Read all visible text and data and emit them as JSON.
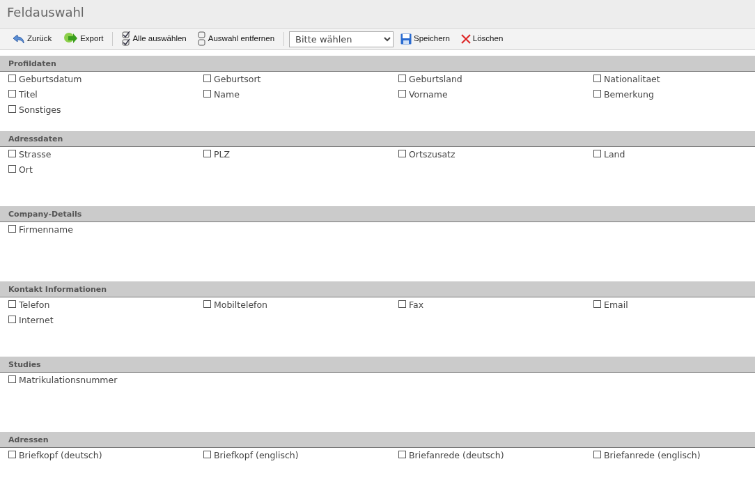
{
  "window": {
    "title": "Feldauswahl"
  },
  "toolbar": [
    {
      "kind": "button",
      "label": "Zurück"
    },
    {
      "kind": "button",
      "label": "Export"
    },
    {
      "kind": "separator"
    },
    {
      "kind": "button",
      "label": "Alle auswählen"
    },
    {
      "kind": "button",
      "label": "Auswahl entfernen"
    },
    {
      "kind": "separator"
    },
    {
      "kind": "select",
      "value": "Bitte wählen"
    },
    {
      "kind": "button",
      "label": "Speichern"
    },
    {
      "kind": "button",
      "label": "Löschen"
    }
  ],
  "sections": [
    {
      "title": "Profildaten",
      "fields": [
        {
          "label": "Geburtsdatum",
          "checked": false
        },
        {
          "label": "Geburtsort",
          "checked": false
        },
        {
          "label": "Geburtsland",
          "checked": false
        },
        {
          "label": "Nationalitaet",
          "checked": false
        },
        {
          "label": "Titel",
          "checked": false
        },
        {
          "label": "Name",
          "checked": false
        },
        {
          "label": "Vorname",
          "checked": false
        },
        {
          "label": "Bemerkung",
          "checked": false
        },
        {
          "label": "Sonstiges",
          "checked": false
        }
      ]
    },
    {
      "title": "Adressdaten",
      "fields": [
        {
          "label": "Strasse",
          "checked": false
        },
        {
          "label": "PLZ",
          "checked": false
        },
        {
          "label": "Ortszusatz",
          "checked": false
        },
        {
          "label": "Land",
          "checked": false
        },
        {
          "label": "Ort",
          "checked": false
        }
      ]
    },
    {
      "title": "Company-Details",
      "fields": [
        {
          "label": "Firmenname",
          "checked": false
        }
      ]
    },
    {
      "title": "Kontakt Informationen",
      "fields": [
        {
          "label": "Telefon",
          "checked": false
        },
        {
          "label": "Mobiltelefon",
          "checked": false
        },
        {
          "label": "Fax",
          "checked": false
        },
        {
          "label": "Email",
          "checked": false
        },
        {
          "label": "Internet",
          "checked": false
        }
      ]
    },
    {
      "title": "Studies",
      "fields": [
        {
          "label": "Matrikulationsnummer",
          "checked": false
        }
      ]
    },
    {
      "title": "Adressen",
      "fields": [
        {
          "label": "Briefkopf (deutsch)",
          "checked": false
        },
        {
          "label": "Briefkopf (englisch)",
          "checked": false
        },
        {
          "label": "Briefanrede (deutsch)",
          "checked": false
        },
        {
          "label": "Briefanrede (englisch)",
          "checked": false
        }
      ]
    }
  ]
}
